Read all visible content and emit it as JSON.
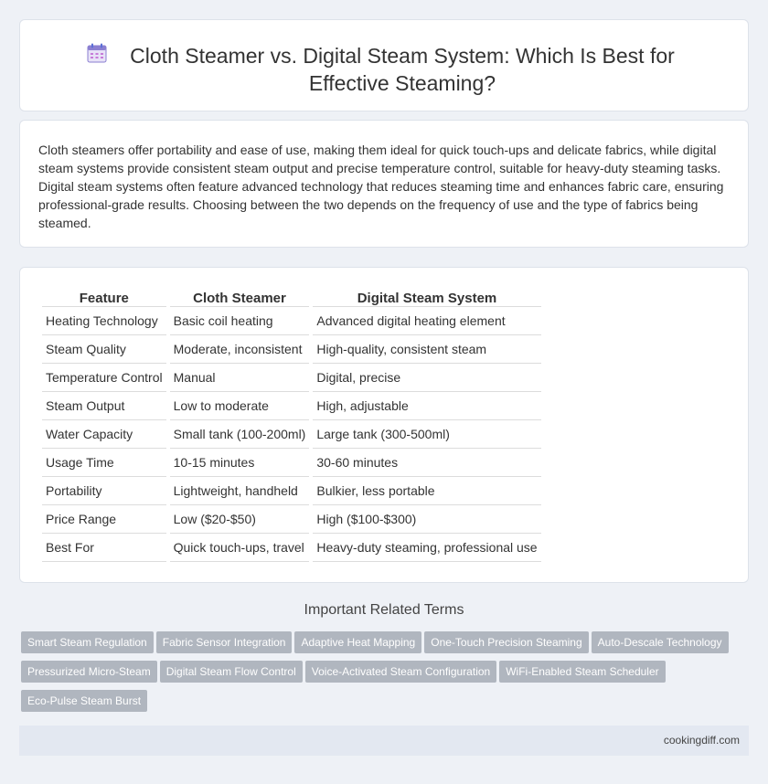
{
  "header": {
    "icon": "document-icon",
    "title": "Cloth Steamer vs. Digital Steam System: Which Is Best for Effective Steaming?"
  },
  "intro": {
    "text": "Cloth steamers offer portability and ease of use, making them ideal for quick touch-ups and delicate fabrics, while digital steam systems provide consistent steam output and precise temperature control, suitable for heavy-duty steaming tasks. Digital steam systems often feature advanced technology that reduces steaming time and enhances fabric care, ensuring professional-grade results. Choosing between the two depends on the frequency of use and the type of fabrics being steamed."
  },
  "table": {
    "headers": [
      "Feature",
      "Cloth Steamer",
      "Digital Steam System"
    ],
    "rows": [
      [
        "Heating Technology",
        "Basic coil heating",
        "Advanced digital heating element"
      ],
      [
        "Steam Quality",
        "Moderate, inconsistent",
        "High-quality, consistent steam"
      ],
      [
        "Temperature Control",
        "Manual",
        "Digital, precise"
      ],
      [
        "Steam Output",
        "Low to moderate",
        "High, adjustable"
      ],
      [
        "Water Capacity",
        "Small tank (100-200ml)",
        "Large tank (300-500ml)"
      ],
      [
        "Usage Time",
        "10-15 minutes",
        "30-60 minutes"
      ],
      [
        "Portability",
        "Lightweight, handheld",
        "Bulkier, less portable"
      ],
      [
        "Price Range",
        "Low ($20-$50)",
        "High ($100-$300)"
      ],
      [
        "Best For",
        "Quick touch-ups, travel",
        "Heavy-duty steaming, professional use"
      ]
    ]
  },
  "related": {
    "heading": "Important Related Terms",
    "tags": [
      "Smart Steam Regulation",
      "Fabric Sensor Integration",
      "Adaptive Heat Mapping",
      "One-Touch Precision Steaming",
      "Auto-Descale Technology",
      "Pressurized Micro-Steam",
      "Digital Steam Flow Control",
      "Voice-Activated Steam Configuration",
      "WiFi-Enabled Steam Scheduler",
      "Eco-Pulse Steam Burst"
    ]
  },
  "footer": {
    "site": "cookingdiff.com"
  }
}
